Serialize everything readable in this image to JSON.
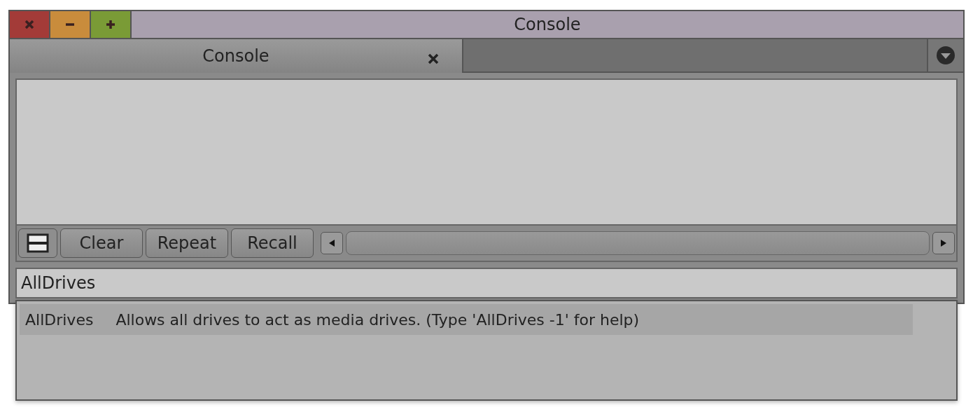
{
  "window": {
    "title": "Console",
    "controls": [
      {
        "kind": "close"
      },
      {
        "kind": "minimize"
      },
      {
        "kind": "zoom"
      }
    ]
  },
  "tabs": [
    {
      "label": "Console",
      "selected": true
    }
  ],
  "toolbar": {
    "buttons": [
      "Clear",
      "Repeat",
      "Recall"
    ]
  },
  "command_input": {
    "value": "AllDrives"
  },
  "suggestions": [
    {
      "command": "AllDrives",
      "description": "Allows all drives to act as media drives. (Type 'AllDrives -1' for help)",
      "selected": true
    }
  ]
}
